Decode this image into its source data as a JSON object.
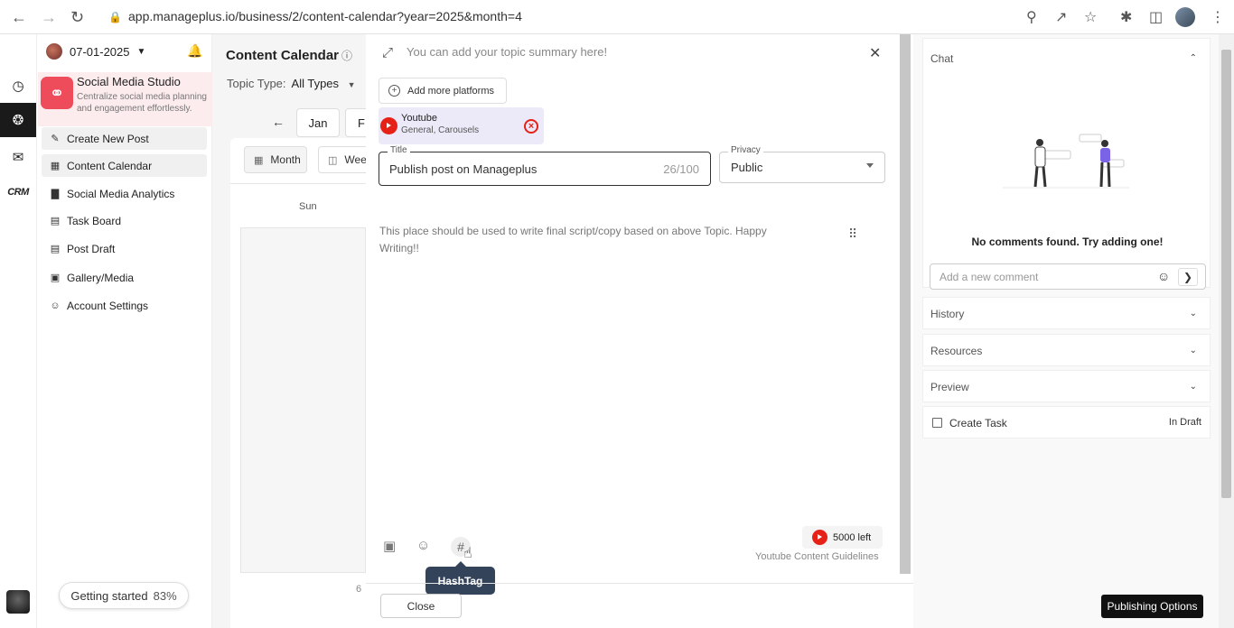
{
  "browser": {
    "url": "app.manageplus.io/business/2/content-calendar?year=2025&month=4"
  },
  "rail": {
    "crm_label": "CRM"
  },
  "sidebar": {
    "date": "07-01-2025",
    "studio_title": "Social Media Studio",
    "studio_subtitle": "Centralize social media planning and engagement effortlessly.",
    "items": [
      {
        "label": "Create New Post",
        "icon": "edit-icon"
      },
      {
        "label": "Content Calendar",
        "icon": "calendar-icon"
      },
      {
        "label": "Social Media Analytics",
        "icon": "chart-icon"
      },
      {
        "label": "Task Board",
        "icon": "board-icon"
      },
      {
        "label": "Post Draft",
        "icon": "draft-icon"
      },
      {
        "label": "Gallery/Media",
        "icon": "gallery-icon"
      },
      {
        "label": "Account Settings",
        "icon": "user-icon"
      }
    ],
    "getting_started": "Getting started",
    "progress": "83%"
  },
  "calendar": {
    "title": "Content Calendar",
    "topic_type_label": "Topic Type:",
    "topic_type_value": "All Types",
    "month_jan": "Jan",
    "month_next": "F",
    "view_month": "Month",
    "view_week": "Wee",
    "day_sun": "Sun",
    "date_six": "6"
  },
  "editor": {
    "summary_placeholder": "You can add your topic summary here!",
    "add_platforms": "Add more platforms",
    "platform_name": "Youtube",
    "platform_types": "General, Carousels",
    "title_label": "Title",
    "title_value": "Publish post on Manageplus",
    "title_count": "26/100",
    "privacy_label": "Privacy",
    "privacy_value": "Public",
    "script_placeholder": "This place should be used to write final script/copy based on above Topic. Happy Writing!!",
    "hashtag_tooltip": "HashTag",
    "chars_left": "5000 left",
    "guidelines": "Youtube Content Guidelines",
    "close_label": "Close"
  },
  "right_panel": {
    "chat_title": "Chat",
    "no_comments": "No comments found. Try adding one!",
    "comment_placeholder": "Add a new comment",
    "history": "History",
    "resources": "Resources",
    "preview": "Preview",
    "create_task": "Create Task",
    "task_status": "In Draft",
    "publish_button": "Publishing Options"
  },
  "colors": {
    "brand": "#ee4b5b",
    "youtube": "#e62117",
    "tooltip": "#33435a"
  }
}
